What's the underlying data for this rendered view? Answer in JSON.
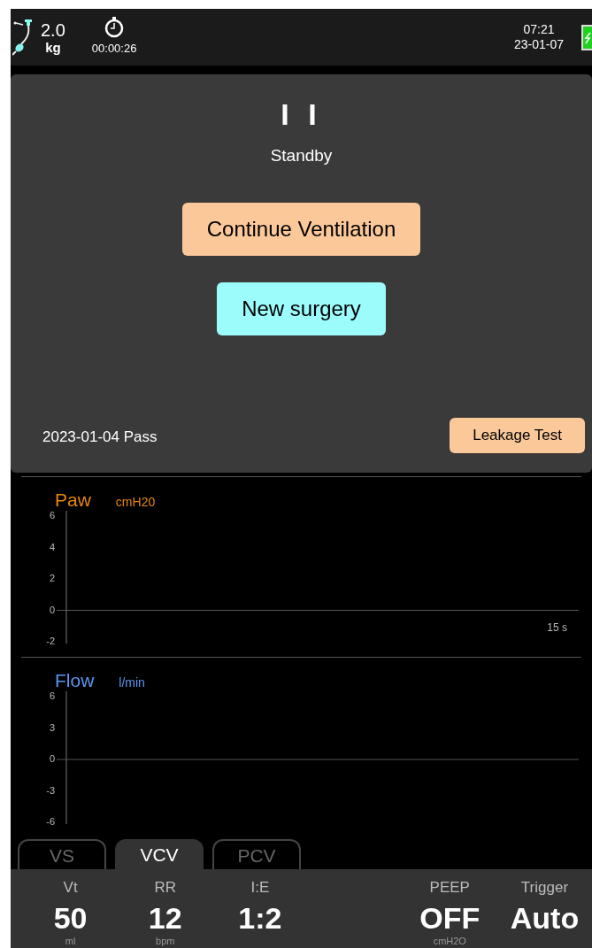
{
  "status_bar": {
    "weight": "2.0",
    "weight_unit": "kg",
    "timer": "00:00:26",
    "time": "07:21",
    "date": "23-01-07"
  },
  "standby_panel": {
    "pause_symbol": "I I",
    "state": "Standby",
    "buttons": [
      {
        "label": "Continue Ventilation",
        "color": "#fbc89a"
      },
      {
        "label": "New surgery",
        "color": "#9cfcfc"
      }
    ],
    "last_test": "2023-01-04 Pass",
    "test_button": "Leakage Test"
  },
  "waveforms": [
    {
      "label": "Paw",
      "unit": "cmH20",
      "color": "#e8860c",
      "y_ticks": [
        "6",
        "4",
        "2",
        "0",
        "-2"
      ],
      "time_scale": "15 s"
    },
    {
      "label": "Flow",
      "unit": "l/min",
      "color": "#5b95f0",
      "y_ticks": [
        "6",
        "3",
        "0",
        "-3",
        "-6"
      ]
    }
  ],
  "mode_tabs": [
    {
      "label": "VS",
      "selected": false
    },
    {
      "label": "VCV",
      "selected": true
    },
    {
      "label": "PCV",
      "selected": false
    }
  ],
  "parameters": [
    {
      "label": "Vt",
      "value": "50",
      "unit": "ml"
    },
    {
      "label": "RR",
      "value": "12",
      "unit": "bpm"
    },
    {
      "label": "I:E",
      "value": "1:2"
    },
    {
      "label": "PEEP",
      "value": "OFF",
      "unit": "cmH2O"
    },
    {
      "label": "Trigger",
      "value": "Auto"
    }
  ]
}
